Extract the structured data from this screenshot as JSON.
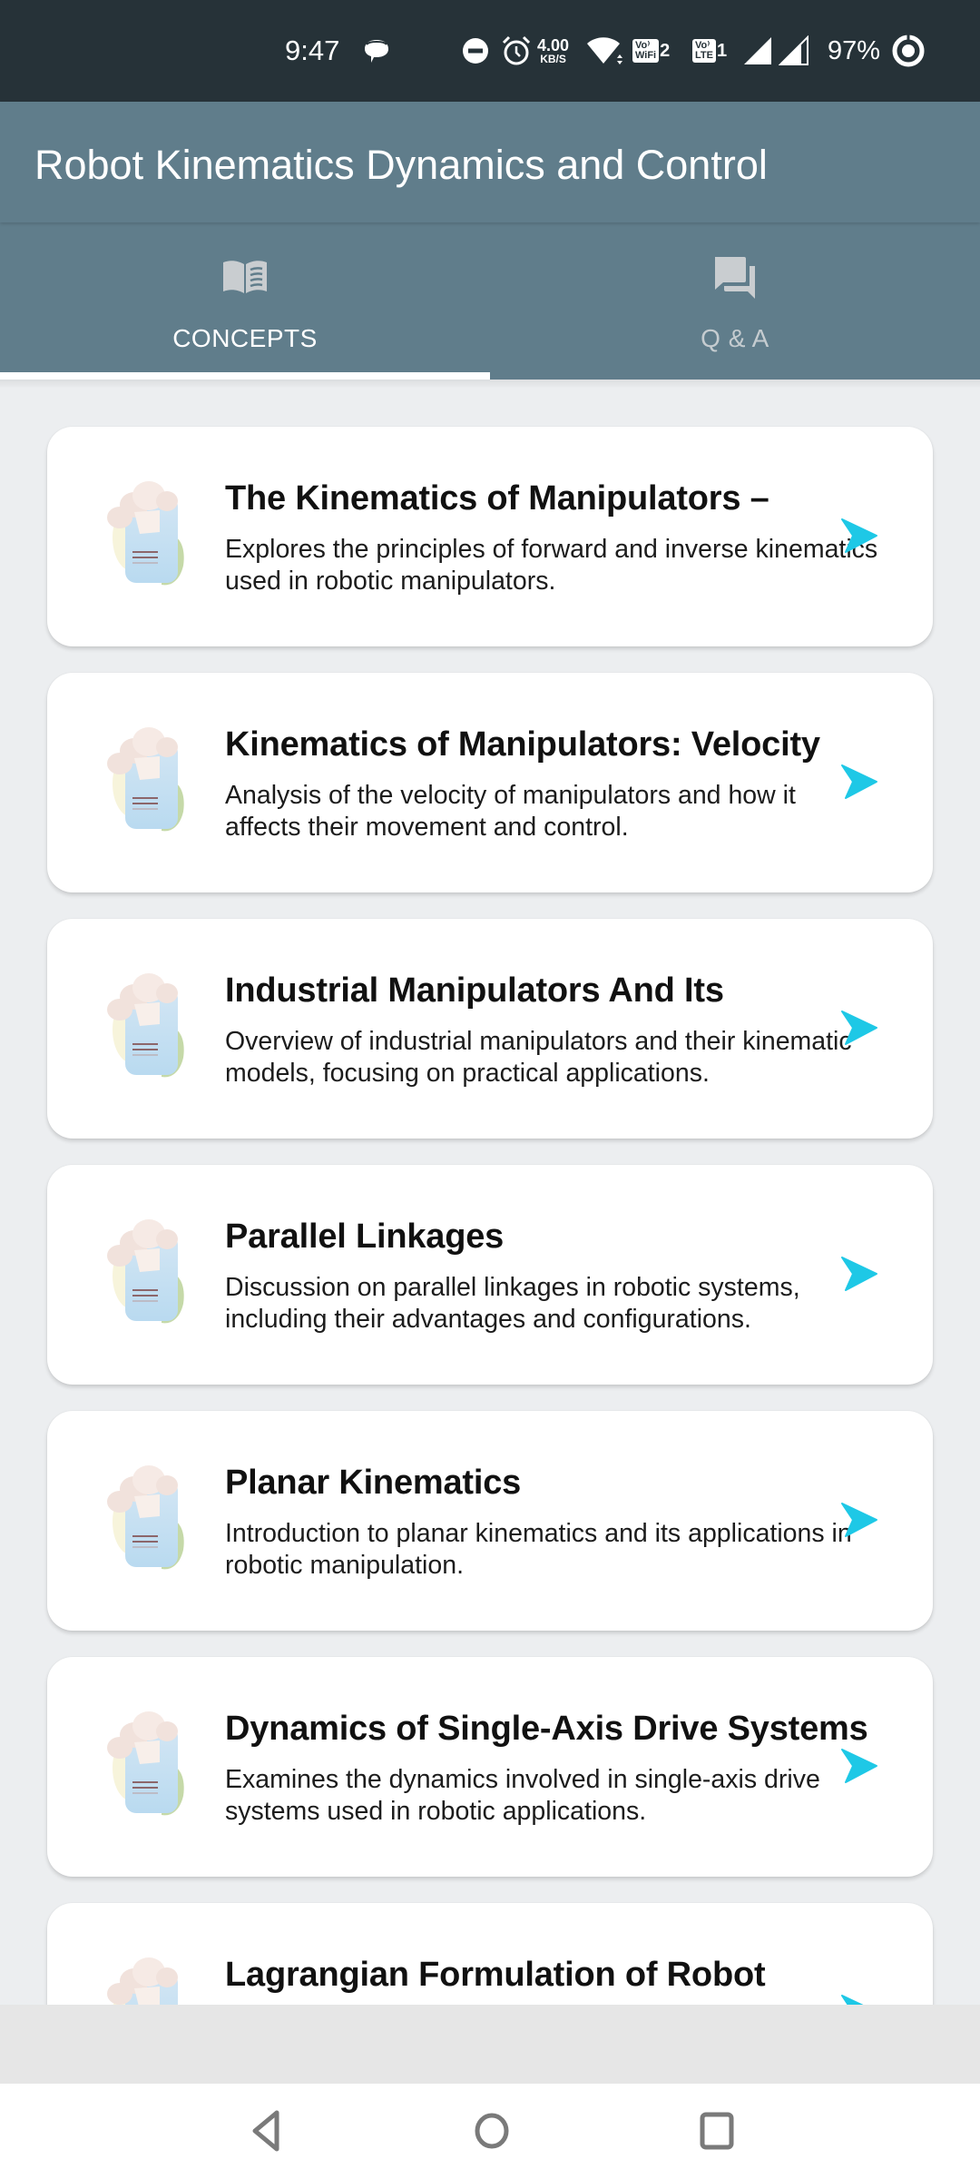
{
  "status_bar": {
    "time": "9:47",
    "net_speed_value": "4.00",
    "net_speed_unit": "KB/S",
    "vowifi_top": "Vo⁾",
    "vowifi_bottom": "WiFi",
    "vowifi_slot": "2",
    "volte_top": "Vo⁾",
    "volte_bottom": "LTE",
    "volte_slot": "1",
    "battery": "97%",
    "icons": [
      "message-bubble-icon",
      "do-not-disturb-icon",
      "alarm-icon",
      "wifi-icon",
      "vowifi-icon",
      "volte-icon",
      "signal-icon",
      "signal-icon",
      "battery-ring-icon"
    ]
  },
  "app_bar": {
    "title": "Robot Kinematics Dynamics and Control"
  },
  "tabs": [
    {
      "label": "CONCEPTS",
      "icon": "book-icon",
      "active": true
    },
    {
      "label": "Q & A",
      "icon": "forum-icon",
      "active": false
    }
  ],
  "colors": {
    "status_bar": "#263238",
    "primary": "#607D8B",
    "accent_arrow": "#1EC8E6",
    "background": "#ECEEF0",
    "card": "#FFFFFF"
  },
  "concepts": [
    {
      "title": "The Kinematics of Manipulators –",
      "description": "Explores the principles of forward and inverse kinematics used in robotic manipulators."
    },
    {
      "title": "Kinematics of Manipulators: Velocity",
      "description": "Analysis of the velocity of manipulators and how it affects their movement and control."
    },
    {
      "title": "Industrial Manipulators And Its",
      "description": "Overview of industrial manipulators and their kinematic models, focusing on practical applications."
    },
    {
      "title": "Parallel Linkages",
      "description": "Discussion on parallel linkages in robotic systems, including their advantages and configurations."
    },
    {
      "title": "Planar Kinematics",
      "description": "Introduction to planar kinematics and its applications in robotic manipulation."
    },
    {
      "title": "Dynamics of Single-Axis Drive Systems",
      "description": "Examines the dynamics involved in single-axis drive systems used in robotic applications."
    },
    {
      "title": "Lagrangian Formulation of Robot",
      "description": ""
    }
  ],
  "nav_bar": {
    "buttons": [
      "back",
      "home",
      "recents"
    ]
  }
}
